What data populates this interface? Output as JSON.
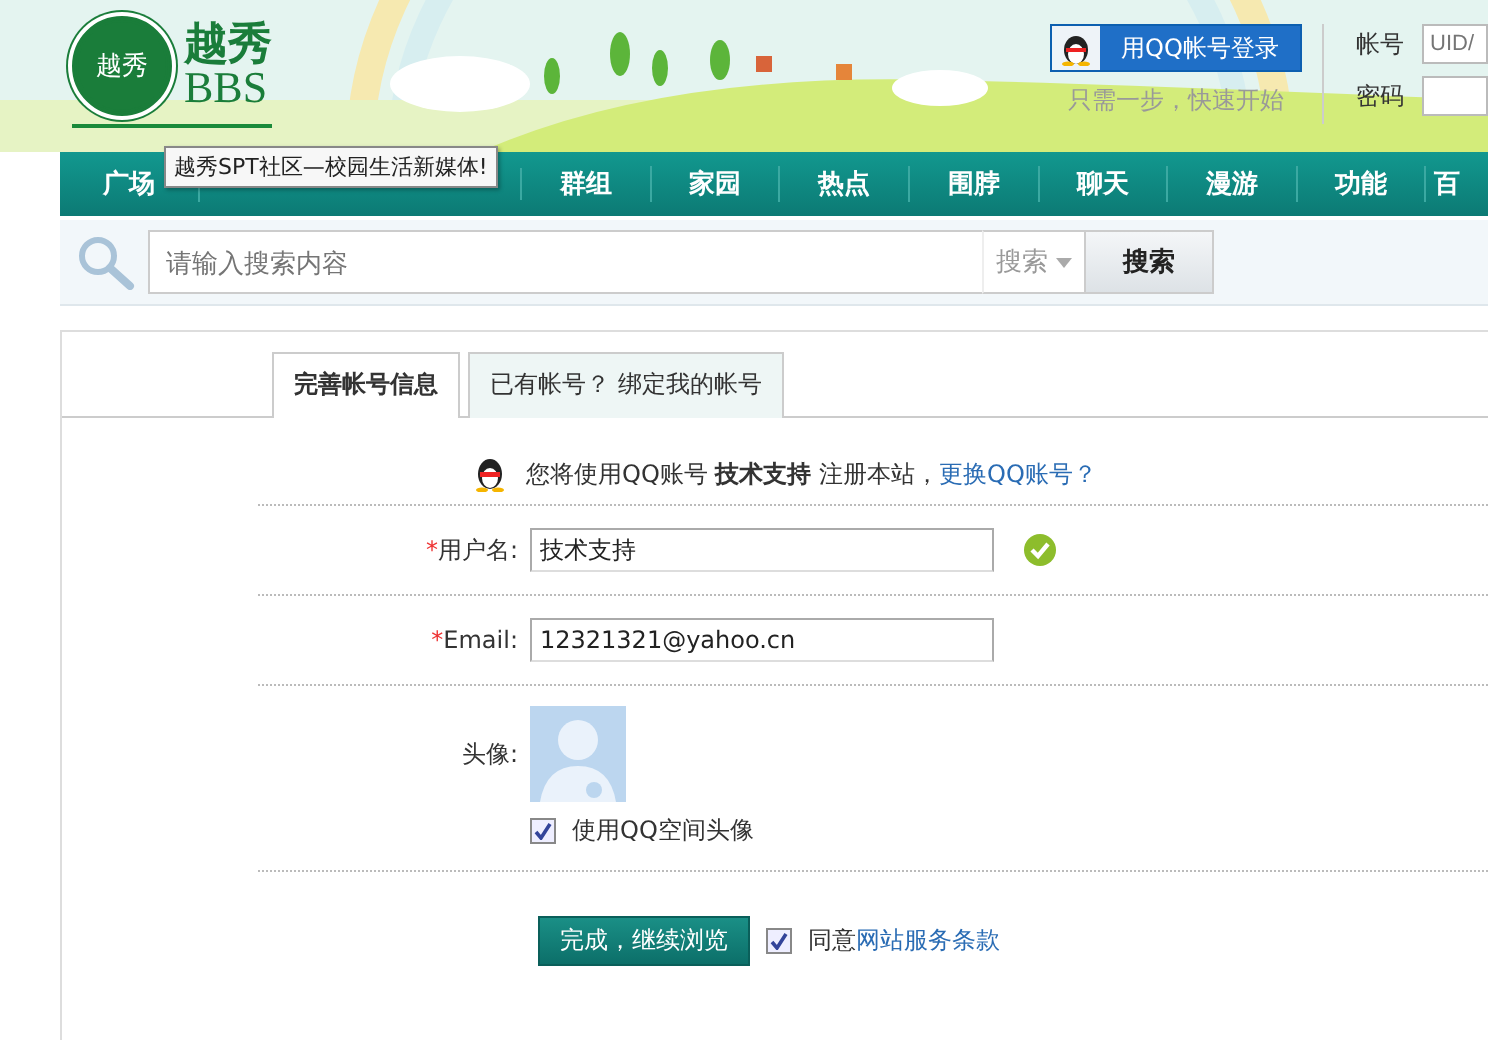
{
  "header": {
    "logo": {
      "seal": "越秀",
      "name": "越秀",
      "sub": "BBS"
    },
    "login": {
      "qq_button": "用QQ帐号登录",
      "hint": "只需一步，快速开始",
      "account_label": "帐号",
      "account_placeholder": "UID/",
      "password_label": "密码"
    }
  },
  "nav": [
    {
      "kind": "item",
      "label": "广场"
    },
    {
      "kind": "covered"
    },
    {
      "kind": "item",
      "label": "群组"
    },
    {
      "kind": "item",
      "label": "家园"
    },
    {
      "kind": "item",
      "label": "热点"
    },
    {
      "kind": "item",
      "label": "围脖"
    },
    {
      "kind": "item",
      "label": "聊天"
    },
    {
      "kind": "item",
      "label": "漫游"
    },
    {
      "kind": "item",
      "label": "功能"
    },
    {
      "kind": "item",
      "label": "百"
    }
  ],
  "tooltip": "越秀SPT社区—校园生活新媒体!",
  "search": {
    "placeholder": "请输入搜索内容",
    "scope": "搜索",
    "button": "搜索"
  },
  "tabs": [
    {
      "label": "完善帐号信息",
      "selected": true
    },
    {
      "label": "已有帐号？ 绑定我的帐号",
      "selected": false
    }
  ],
  "notice": {
    "text": "您将使用QQ账号 **技术支持** 注册本站，",
    "link": "更换QQ账号？"
  },
  "fields": [
    {
      "mark": "*",
      "label": "用户名:",
      "value": "技术支持",
      "valid": true
    },
    {
      "mark": "*",
      "label": "Email:",
      "value": "12321321@yahoo.cn",
      "valid": false
    }
  ],
  "avatar": {
    "label": "头像:",
    "option": {
      "label": "使用QQ空间头像",
      "checked": true
    }
  },
  "submit": "完成，继续浏览",
  "agree": {
    "checked": true,
    "text": "同意",
    "link": "网站服务条款"
  }
}
